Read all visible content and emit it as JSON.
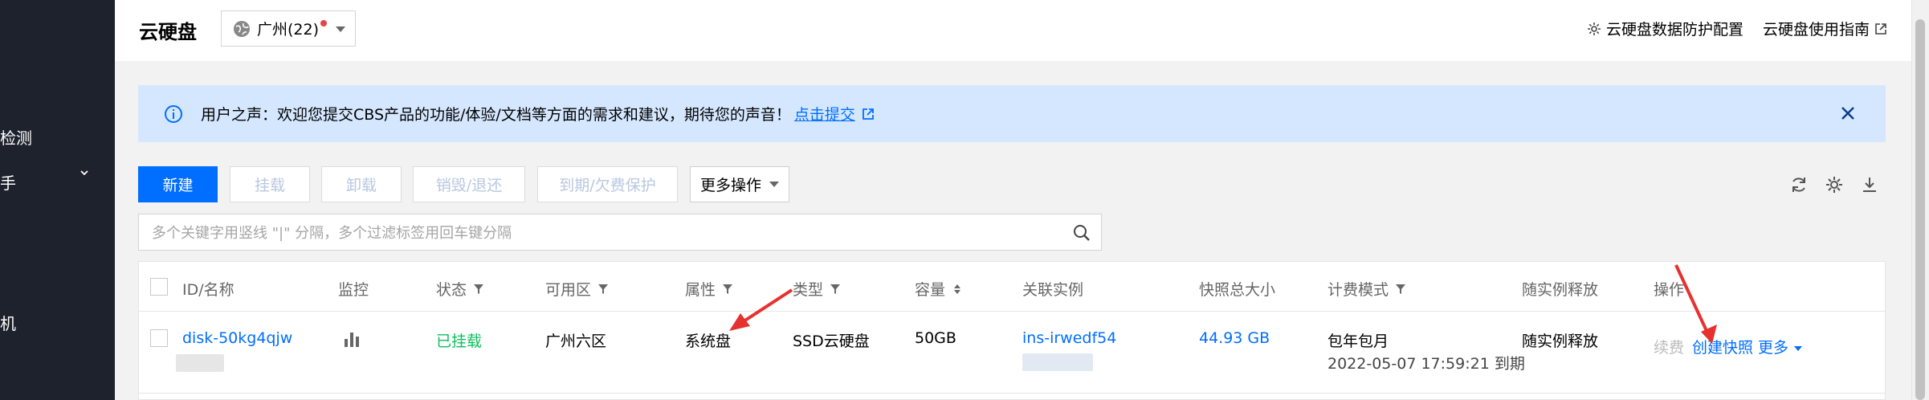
{
  "sidebar": {
    "items": [
      {
        "label": "检测"
      },
      {
        "label": "手"
      },
      {
        "label": "机"
      }
    ]
  },
  "header": {
    "title": "云硬盘",
    "region": "广州(22)",
    "links": [
      {
        "label": "云硬盘数据防护配置",
        "icon": "gear-icon"
      },
      {
        "label": "云硬盘使用指南",
        "icon": "external-link-icon"
      }
    ]
  },
  "banner": {
    "text": "用户之声：欢迎您提交CBS产品的功能/体验/文档等方面的需求和建议，期待您的声音！",
    "link": "点击提交"
  },
  "toolbar": {
    "new_label": "新建",
    "mount_label": "挂载",
    "unmount_label": "卸载",
    "destroy_label": "销毁/退还",
    "expire_label": "到期/欠费保护",
    "more_label": "更多操作",
    "icons": [
      "refresh-icon",
      "settings-icon",
      "download-icon"
    ]
  },
  "search": {
    "placeholder": "多个关键字用竖线 \"|\" 分隔，多个过滤标签用回车键分隔"
  },
  "table": {
    "headers": {
      "id": "ID/名称",
      "monitor": "监控",
      "status": "状态",
      "zone": "可用区",
      "attr": "属性",
      "type": "类型",
      "capacity": "容量",
      "instance": "关联实例",
      "snapshot": "快照总大小",
      "billing": "计费模式",
      "release": "随实例释放",
      "ops": "操作"
    },
    "rows": [
      {
        "id": "disk-50kg4qjw",
        "status": "已挂载",
        "zone": "广州六区",
        "attr": "系统盘",
        "type": "SSD云硬盘",
        "capacity": "50GB",
        "instance": "ins-irwedf54",
        "snapshot": "44.93 GB",
        "billing": "包年包月",
        "expiry": "2022-05-07 17:59:21 到期",
        "release": "随实例释放",
        "op_renew": "续费",
        "op_snapshot": "创建快照",
        "op_more": "更多"
      }
    ]
  },
  "colors": {
    "accent": "#006eff",
    "sidebar": "#1e222d",
    "banner": "#d5e7ff",
    "success": "#0abf5b",
    "annotation": "#e5312f"
  }
}
